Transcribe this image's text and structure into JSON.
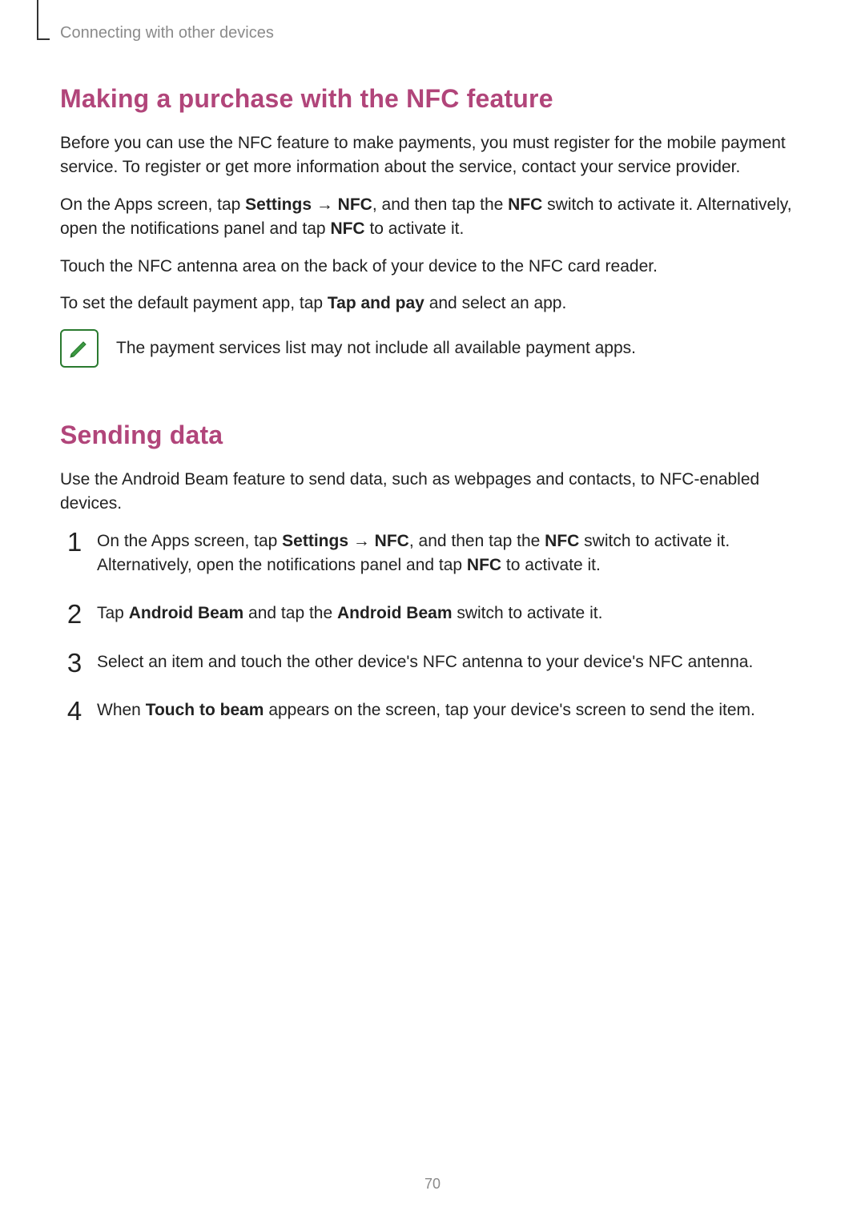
{
  "breadcrumb": "Connecting with other devices",
  "section1": {
    "title": "Making a purchase with the NFC feature",
    "p1": "Before you can use the NFC feature to make payments, you must register for the mobile payment service. To register or get more information about the service, contact your service provider.",
    "p2a": "On the Apps screen, tap ",
    "p2b": "Settings",
    "p2c": " → ",
    "p2d": "NFC",
    "p2e": ", and then tap the ",
    "p2f": "NFC",
    "p2g": " switch to activate it. Alternatively, open the notifications panel and tap ",
    "p2h": "NFC",
    "p2i": " to activate it.",
    "p3": "Touch the NFC antenna area on the back of your device to the NFC card reader.",
    "p4a": "To set the default payment app, tap ",
    "p4b": "Tap and pay",
    "p4c": " and select an app.",
    "note": "The payment services list may not include all available payment apps."
  },
  "section2": {
    "title": "Sending data",
    "intro": "Use the Android Beam feature to send data, such as webpages and contacts, to NFC-enabled devices.",
    "step1a": "On the Apps screen, tap ",
    "step1b": "Settings",
    "step1c": " → ",
    "step1d": "NFC",
    "step1e": ", and then tap the ",
    "step1f": "NFC",
    "step1g": " switch to activate it. Alternatively, open the notifications panel and tap ",
    "step1h": "NFC",
    "step1i": " to activate it.",
    "step2a": "Tap ",
    "step2b": "Android Beam",
    "step2c": " and tap the ",
    "step2d": "Android Beam",
    "step2e": " switch to activate it.",
    "step3": "Select an item and touch the other device's NFC antenna to your device's NFC antenna.",
    "step4a": "When ",
    "step4b": "Touch to beam",
    "step4c": " appears on the screen, tap your device's screen to send the item."
  },
  "pageNumber": "70"
}
